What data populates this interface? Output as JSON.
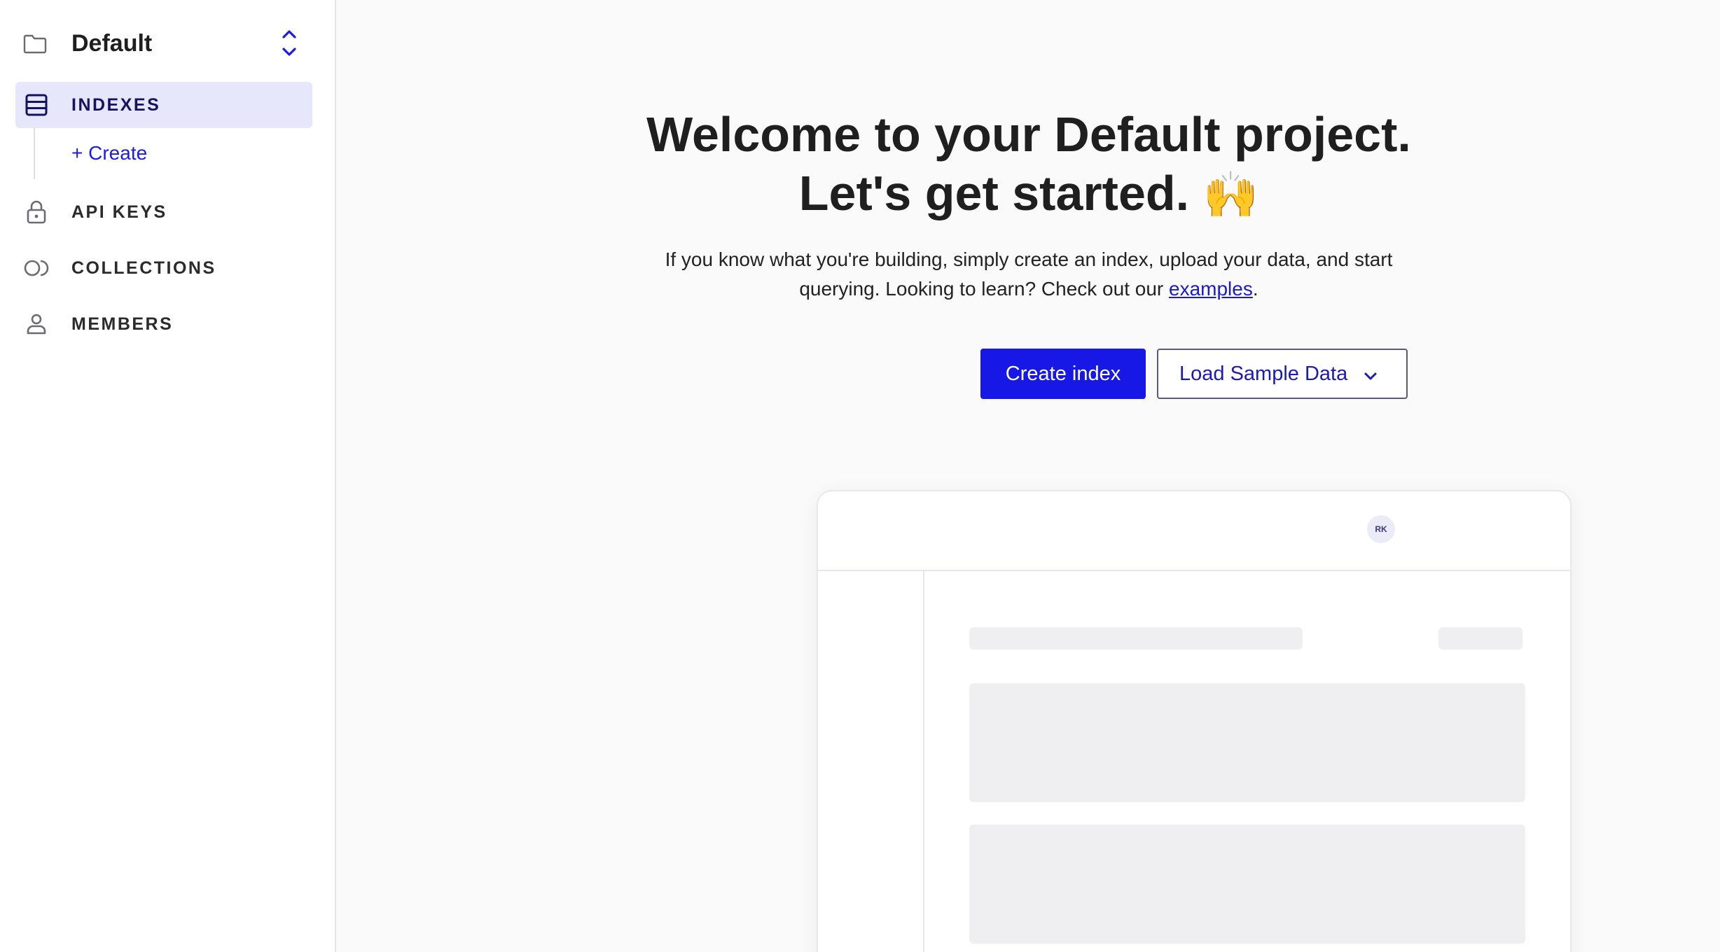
{
  "sidebar": {
    "project": {
      "name": "Default",
      "icon": "folder-icon",
      "switch_icon": "chevron-up-down-icon"
    },
    "items": [
      {
        "label": "INDEXES",
        "icon": "database-icon",
        "active": true
      },
      {
        "label": "API KEYS",
        "icon": "lock-icon",
        "active": false
      },
      {
        "label": "COLLECTIONS",
        "icon": "collections-icon",
        "active": false
      },
      {
        "label": "MEMBERS",
        "icon": "user-icon",
        "active": false
      }
    ],
    "create_label": "+ Create"
  },
  "main": {
    "title_line1": "Welcome to your Default project.",
    "title_line2": "Let's get started.",
    "title_emoji": "🙌",
    "intro_part1": "If you know what you're building, simply create an index, upload your data, and start",
    "intro_part2": "querying. Looking to learn? Check out our ",
    "intro_link": "examples",
    "intro_end": ".",
    "primary_button": "Create index",
    "secondary_button": "Load Sample Data",
    "secondary_button_icon": "chevron-down-icon"
  },
  "preview": {
    "avatar_initials": "RK"
  },
  "colors": {
    "accent": "#1717e6",
    "active_bg": "#e7e7fb",
    "background": "#fafafa"
  }
}
